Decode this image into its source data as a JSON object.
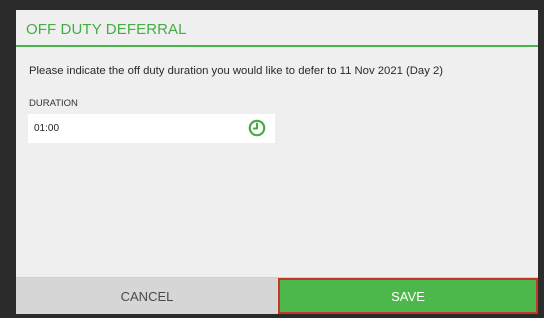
{
  "dialog": {
    "title": "OFF DUTY DEFERRAL",
    "message": "Please indicate the off duty duration you would like to defer to 11 Nov 2021 (Day 2)",
    "duration": {
      "label": "DURATION",
      "value": "01:00",
      "icon": "clock-icon"
    },
    "buttons": {
      "cancel_label": "CANCEL",
      "save_label": "SAVE"
    }
  },
  "colors": {
    "accent": "#45ac45",
    "save_bg": "#4cb84c",
    "cancel_bg": "#d6d6d6",
    "save_border": "#c0392b",
    "background": "#efefef"
  }
}
